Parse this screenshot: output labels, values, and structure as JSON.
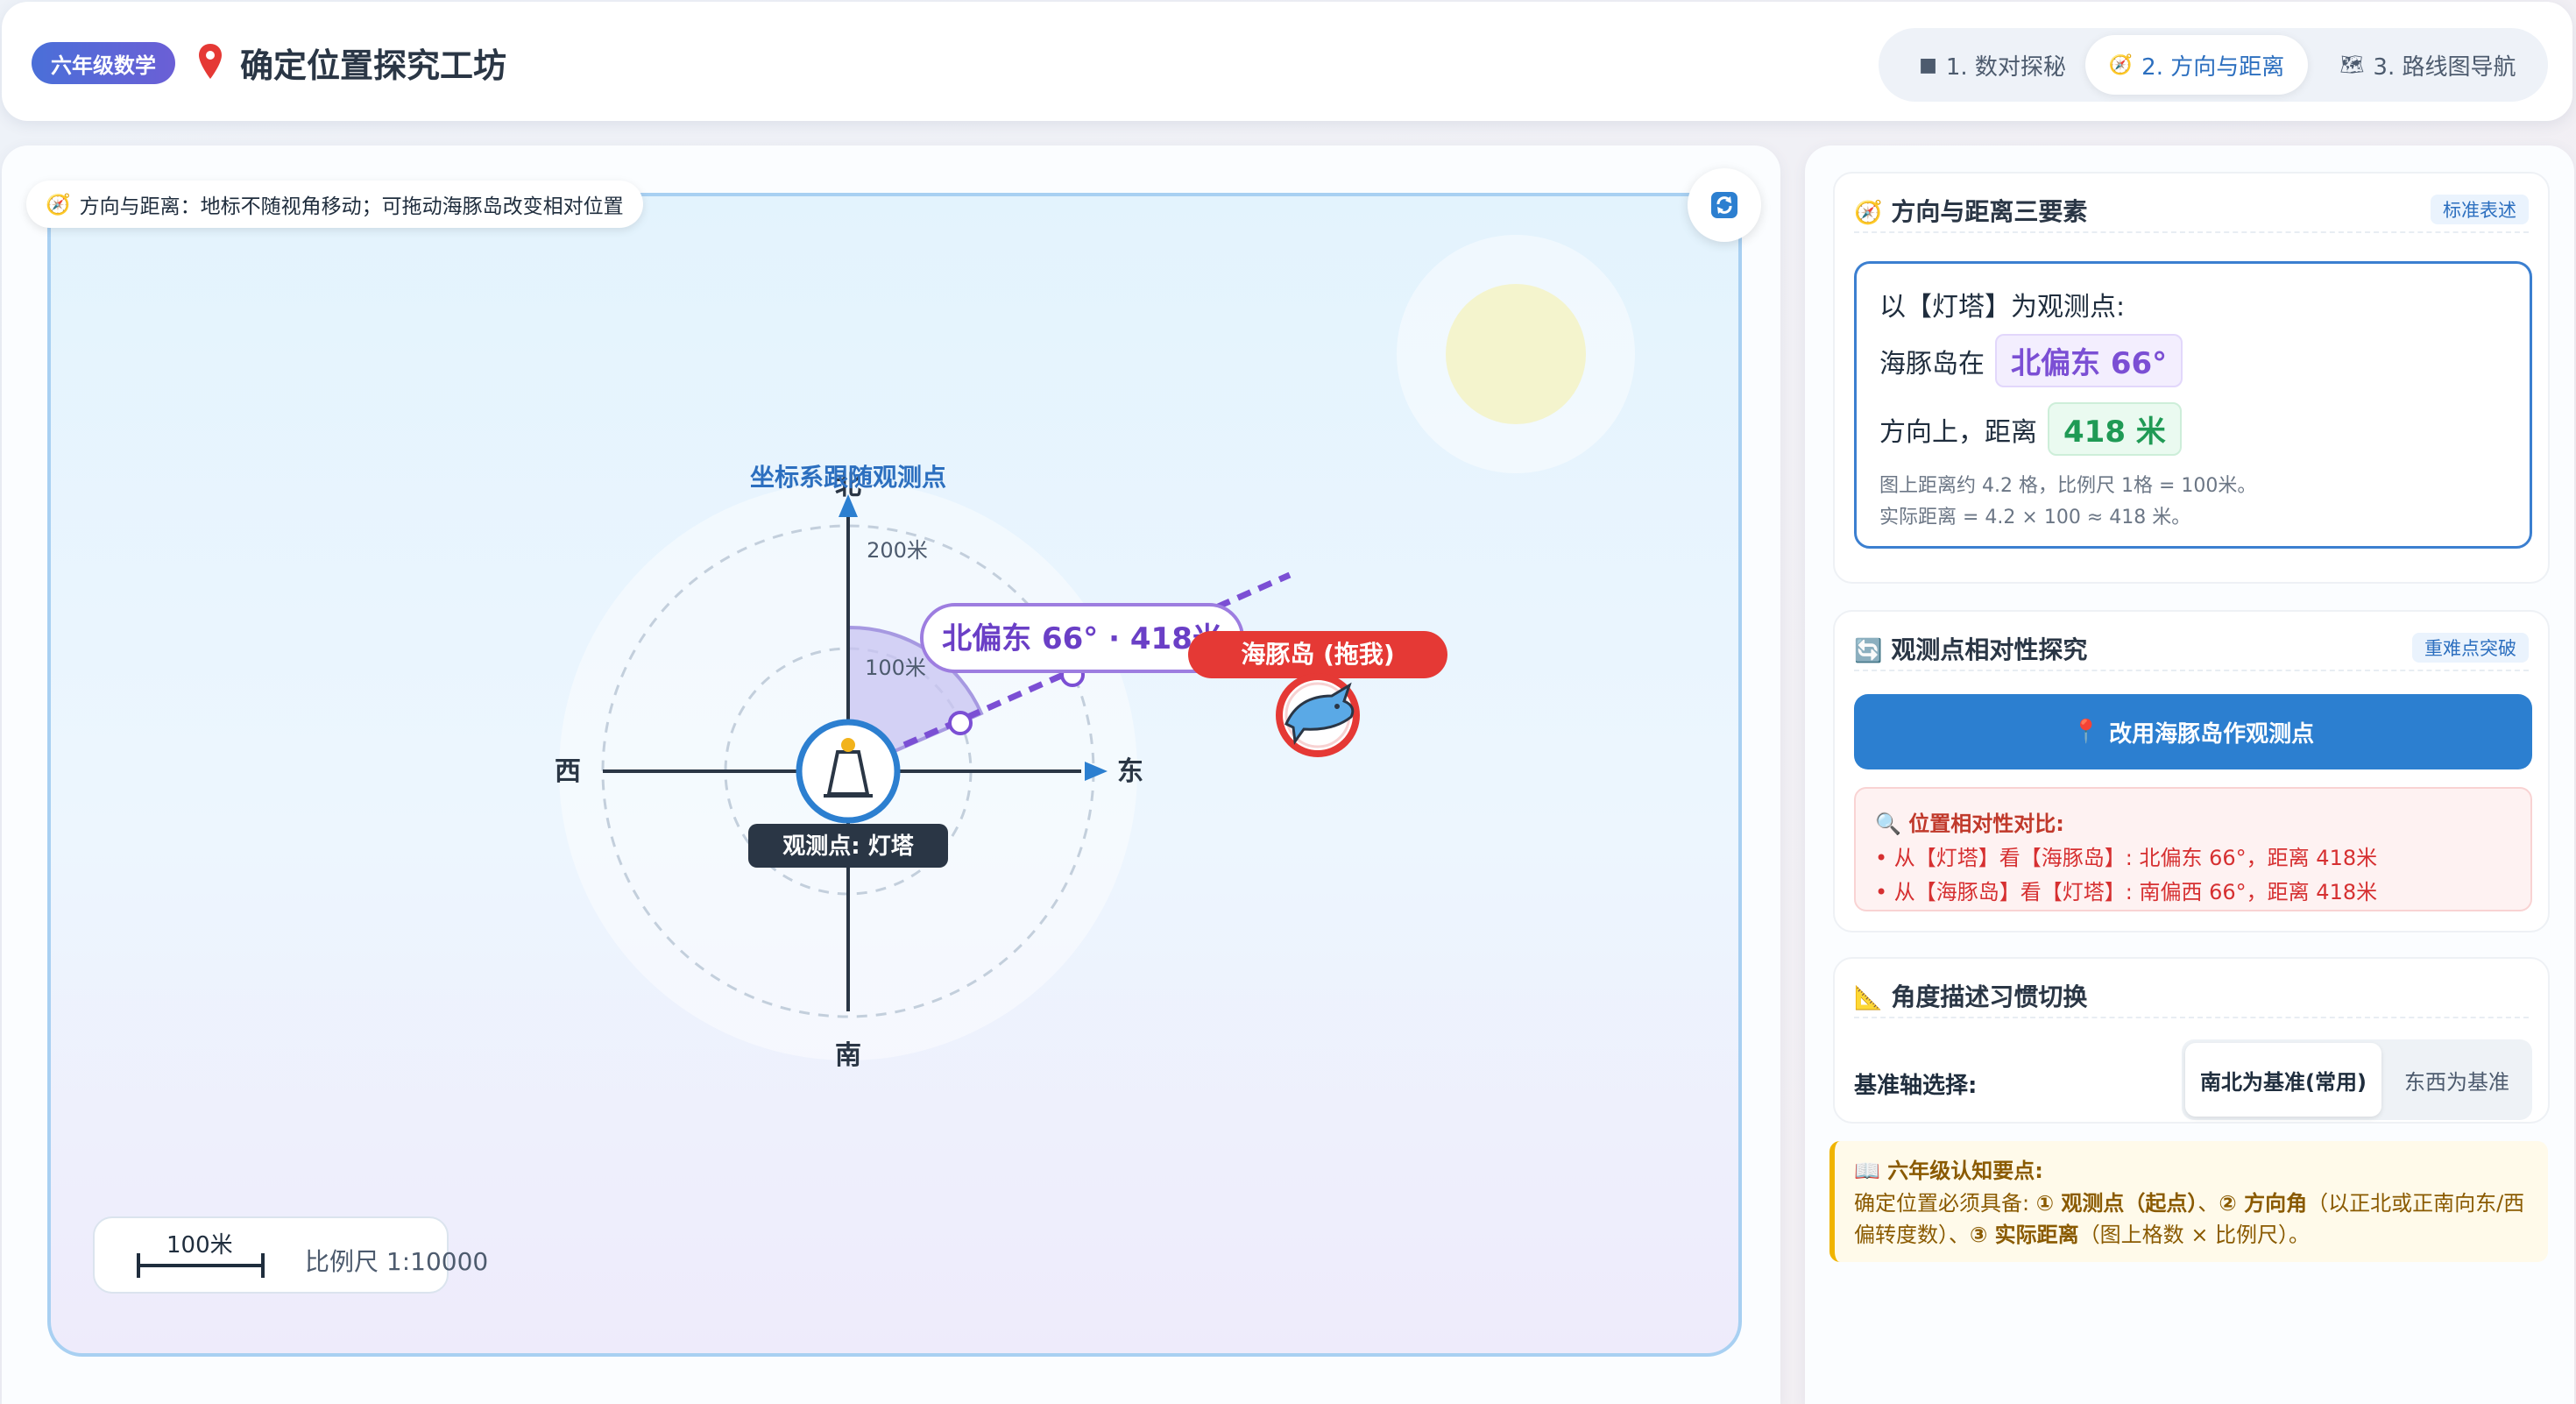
{
  "header": {
    "grade_badge": "六年级数学",
    "title": "确定位置探究工坊",
    "tabs": [
      {
        "icon": "■",
        "label": "1. 数对探秘",
        "active": false
      },
      {
        "icon": "🧭",
        "label": "2. 方向与距离",
        "active": true
      },
      {
        "icon": "🗺",
        "label": "3. 路线图导航",
        "active": false
      }
    ]
  },
  "map": {
    "hint_icon": "🧭",
    "hint": "方向与距离：地标不随视角移动；可拖动海豚岛改变相对位置",
    "axis_caption": "坐标系跟随观测点",
    "directions": {
      "north": "北",
      "south": "南",
      "east": "东",
      "west": "西"
    },
    "ring_labels": {
      "inner": "100米",
      "outer": "200米"
    },
    "observer_label": "观测点: 灯塔",
    "target_label": "海豚岛 (拖我)",
    "bearing_label": "北偏东 66° · 418米",
    "bearing_value": {
      "reference": "北",
      "turn": "东",
      "angle_deg": 66,
      "distance_m": 418
    },
    "scale": {
      "bar_label": "100米",
      "ratio": "比例尺 1:10000"
    },
    "colors": {
      "accent_blue": "#2c7fd0",
      "bearing_purple": "#7b4fd4",
      "target_red": "#e53935"
    }
  },
  "panel": {
    "card1": {
      "title": "方向与距离三要素",
      "tag": "标准表述",
      "line1": "以【灯塔】为观测点:",
      "line2_prefix": "海豚岛在",
      "direction_value": "北偏东  66°",
      "line3_prefix": "方向上，距离",
      "distance_value": "418  米",
      "note1": "图上距离约 4.2 格，比例尺 1格 = 100米。",
      "note2": "实际距离 = 4.2 × 100 ≈ 418 米。"
    },
    "card2": {
      "title": "观测点相对性探究",
      "tag": "重难点突破",
      "button": "改用海豚岛作观测点",
      "compare_title": "位置相对性对比:",
      "compare_items": [
        "• 从【灯塔】看【海豚岛】: 北偏东 66°，距离 418米",
        "• 从【海豚岛】看【灯塔】: 南偏西 66°，距离 418米"
      ]
    },
    "card3": {
      "title": "角度描述习惯切换",
      "axis_label": "基准轴选择:",
      "options": [
        "南北为基准(常用)",
        "东西为基准"
      ],
      "selected": "南北为基准(常用)"
    },
    "tip": {
      "title": "六年级认知要点:",
      "body_1": "确定位置必须具备: ",
      "k1": "① 观测点（起点）",
      "sep1": "、",
      "k2": "② 方向角",
      "body_2": "（以正北或正南向东/西偏转度数）、",
      "k3": "③ 实际距离",
      "body_3": "（图上格数 × 比例尺）。"
    }
  }
}
